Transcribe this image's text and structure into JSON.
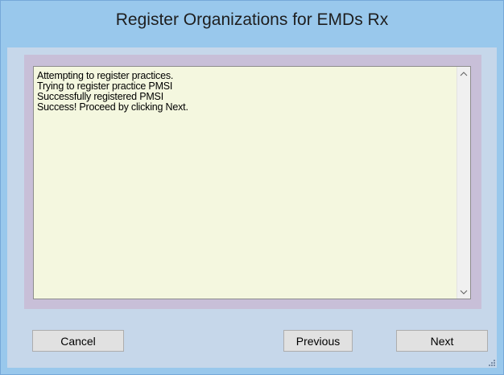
{
  "window": {
    "title": "Register Organizations for EMDs Rx"
  },
  "log": {
    "lines": [
      "Attempting to register practices.",
      "Trying to register practice PMSI",
      "Successfully registered PMSI",
      "Success! Proceed by clicking Next."
    ]
  },
  "buttons": {
    "cancel": "Cancel",
    "previous": "Previous",
    "next": "Next"
  },
  "icons": {
    "scroll_up": "chevron-up-icon",
    "scroll_down": "chevron-down-icon",
    "resize": "resize-grip-icon"
  },
  "colors": {
    "title_bar": "#99c8ec",
    "client_bg": "#c6d7ea",
    "log_bg": "#f4f7df"
  }
}
